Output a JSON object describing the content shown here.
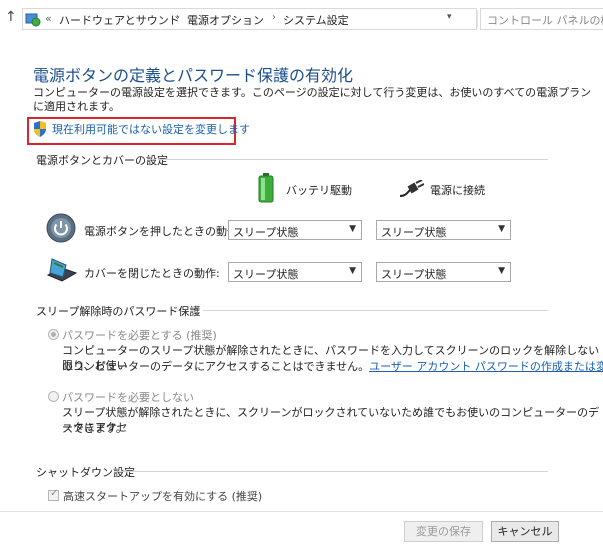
{
  "address_bar": {
    "prefix": "«",
    "crumbs": [
      "ハードウェアとサウンド",
      "電源オプション",
      "システム設定"
    ],
    "search_placeholder": "コントロール パネルの検索"
  },
  "page": {
    "title": "電源ボタンの定義とパスワード保護の有効化",
    "description": "コンピューターの電源設定を選択できます。このページの設定に対して行う変更は、お使いのすべての電源プランに適用されます。",
    "change_link": "現在利用可能ではない設定を変更します"
  },
  "power_buttons": {
    "section_title": "電源ボタンとカバーの設定",
    "battery_label": "バッテリ駆動",
    "plugged_label": "電源に接続",
    "power_button_row": {
      "label": "電源ボタンを押したときの動作:",
      "battery_value": "スリープ状態",
      "plugged_value": "スリープ状態"
    },
    "lid_row": {
      "label": "カバーを閉じたときの動作:",
      "battery_value": "スリープ状態",
      "plugged_value": "スリープ状態"
    }
  },
  "password": {
    "section_title": "スリープ解除時のパスワード保護",
    "require": {
      "label": "パスワードを必要とする (推奨)",
      "selected": true,
      "desc_line1": "コンピューターのスリープ状態が解除されたときに、パスワードを入力してスクリーンのロックを解除しない限り、お使い",
      "desc_line2": "のコンピューターのデータにアクセスすることはできません。",
      "link": "ユーザー アカウント パスワードの作成または変更"
    },
    "no_require": {
      "label": "パスワードを必要としない",
      "selected": false,
      "desc_line1": "スリープ状態が解除されたときに、スクリーンがロックされていないため誰でもお使いのコンピューターのデータにアクセ",
      "desc_line2": "スできます。"
    }
  },
  "shutdown": {
    "section_title": "シャットダウン設定",
    "fast_startup_label": "高速スタートアップを有効にする (推奨)",
    "fast_startup_checked": true
  },
  "buttons": {
    "save": "変更の保存",
    "cancel": "キャンセル"
  },
  "colors": {
    "title_blue": "#1b4f8c",
    "link_blue": "#1a5fb4",
    "highlight_red": "#d8262c"
  }
}
